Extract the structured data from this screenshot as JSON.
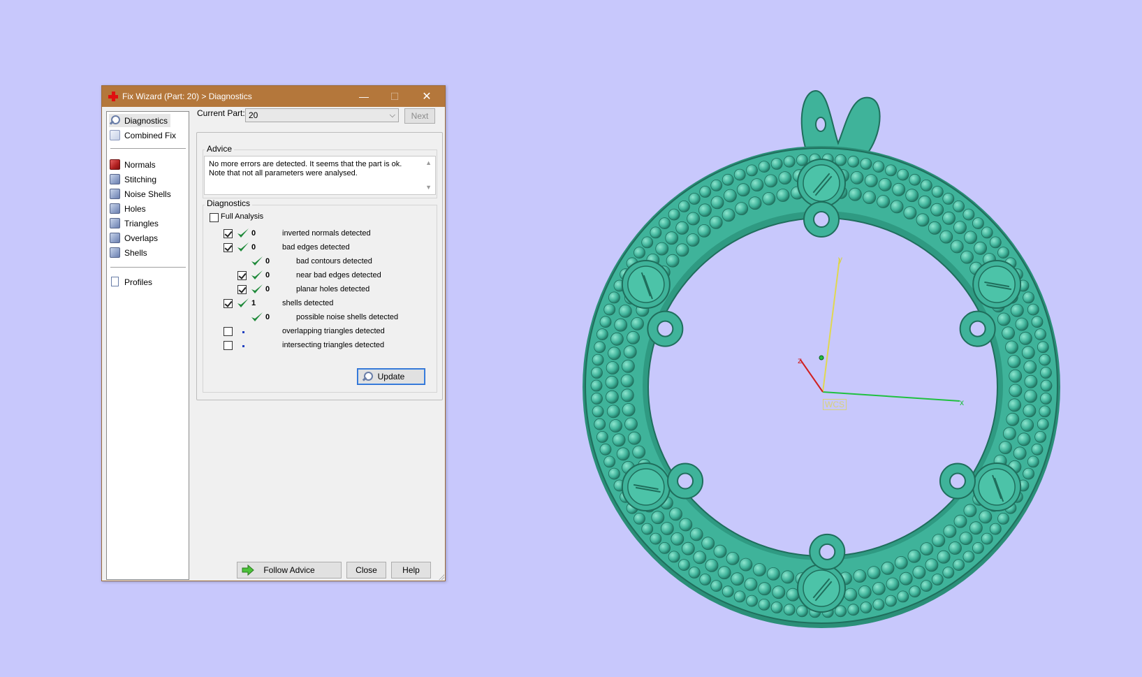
{
  "window": {
    "title": "Fix Wizard (Part: 20) > Diagnostics",
    "minimize_glyph": "—",
    "maximize_glyph": "☐",
    "close_glyph": "✕"
  },
  "nav": {
    "items": [
      {
        "label": "Diagnostics",
        "icon": "magnifier-icon",
        "selected": true
      },
      {
        "label": "Combined Fix",
        "icon": "combined-fix-icon"
      },
      {
        "label": "Normals",
        "icon": "normals-icon"
      },
      {
        "label": "Stitching",
        "icon": "stitching-icon"
      },
      {
        "label": "Noise Shells",
        "icon": "noise-shells-icon"
      },
      {
        "label": "Holes",
        "icon": "holes-icon"
      },
      {
        "label": "Triangles",
        "icon": "triangles-icon"
      },
      {
        "label": "Overlaps",
        "icon": "overlaps-icon"
      },
      {
        "label": "Shells",
        "icon": "shells-icon"
      },
      {
        "label": "Profiles",
        "icon": "profiles-icon"
      }
    ]
  },
  "current_part": {
    "label": "Current Part:",
    "value": "20",
    "next_label": "Next"
  },
  "advice": {
    "legend": "Advice",
    "line1": "No more errors are detected. It seems that the part is ok.",
    "line2": "Note that not all parameters were analysed."
  },
  "diagnostics": {
    "legend": "Diagnostics",
    "full_analysis_label": "Full Analysis",
    "full_analysis_checked": false,
    "rows": [
      {
        "checked": true,
        "status": "ok",
        "count": "0",
        "label": "inverted normals detected"
      },
      {
        "checked": true,
        "status": "ok",
        "count": "0",
        "label": "bad edges detected"
      },
      {
        "checked": null,
        "status": "ok",
        "count": "0",
        "label": "bad contours detected"
      },
      {
        "checked": true,
        "status": "ok",
        "count": "0",
        "label": "near bad edges detected"
      },
      {
        "checked": true,
        "status": "ok",
        "count": "0",
        "label": "planar holes detected"
      },
      {
        "checked": true,
        "status": "ok",
        "count": "1",
        "label": "shells detected"
      },
      {
        "checked": null,
        "status": "ok",
        "count": "0",
        "label": "possible noise shells detected"
      },
      {
        "checked": false,
        "status": "pending",
        "count": "",
        "label": "overlapping triangles detected"
      },
      {
        "checked": false,
        "status": "pending",
        "count": "",
        "label": "intersecting triangles detected"
      }
    ],
    "update_label": "Update"
  },
  "buttons": {
    "follow_advice": "Follow Advice",
    "close": "Close",
    "help": "Help"
  },
  "viewport": {
    "background": "#c8c8fc",
    "model_color": "#3fb39a",
    "wcs_label": "WCS",
    "axis_x": "x",
    "axis_y": "y",
    "axis_z": "z"
  }
}
